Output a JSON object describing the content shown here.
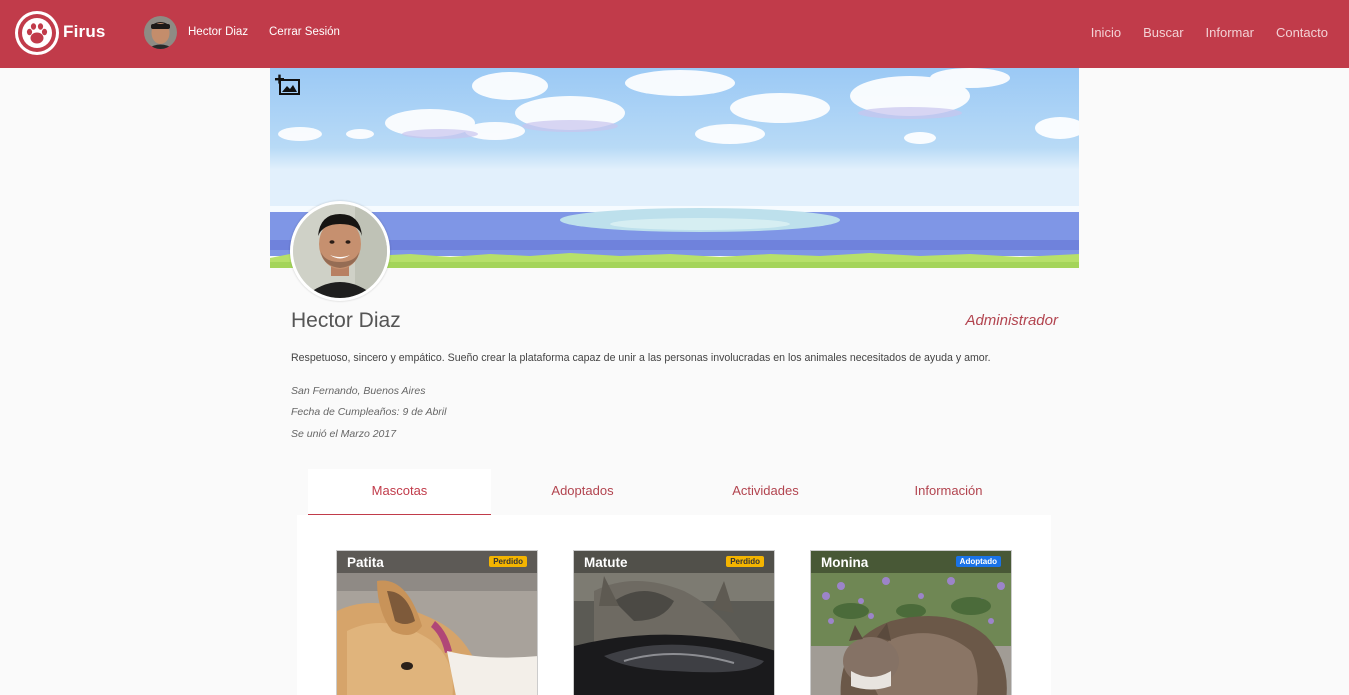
{
  "nav": {
    "brand": "Firus",
    "user_name": "Hector Diaz",
    "logout": "Cerrar Sesión",
    "links": [
      "Inicio",
      "Buscar",
      "Informar",
      "Contacto"
    ]
  },
  "profile": {
    "name": "Hector Diaz",
    "role": "Administrador",
    "bio": "Respetuoso, sincero y empático. Sueño crear la plataforma capaz de unir a las personas involucradas en los animales necesitados de ayuda y amor.",
    "location": "San Fernando, Buenos Aires",
    "birthday": "Fecha de Cumpleaños: 9 de Abril",
    "joined": "Se unió el Marzo 2017"
  },
  "tabs": [
    {
      "label": "Mascotas",
      "active": true
    },
    {
      "label": "Adoptados",
      "active": false
    },
    {
      "label": "Actividades",
      "active": false
    },
    {
      "label": "Información",
      "active": false
    }
  ],
  "pets": [
    {
      "name": "Patita",
      "status": "Perdido"
    },
    {
      "name": "Matute",
      "status": "Perdido"
    },
    {
      "name": "Monina",
      "status": "Adoptado"
    }
  ],
  "colors": {
    "brand": "#c13b4a",
    "lost_badge": "#f4b400",
    "adopted_badge": "#1a73e8"
  },
  "icons": {
    "logo": "paw-icon",
    "add_cover": "add-photo-icon"
  }
}
